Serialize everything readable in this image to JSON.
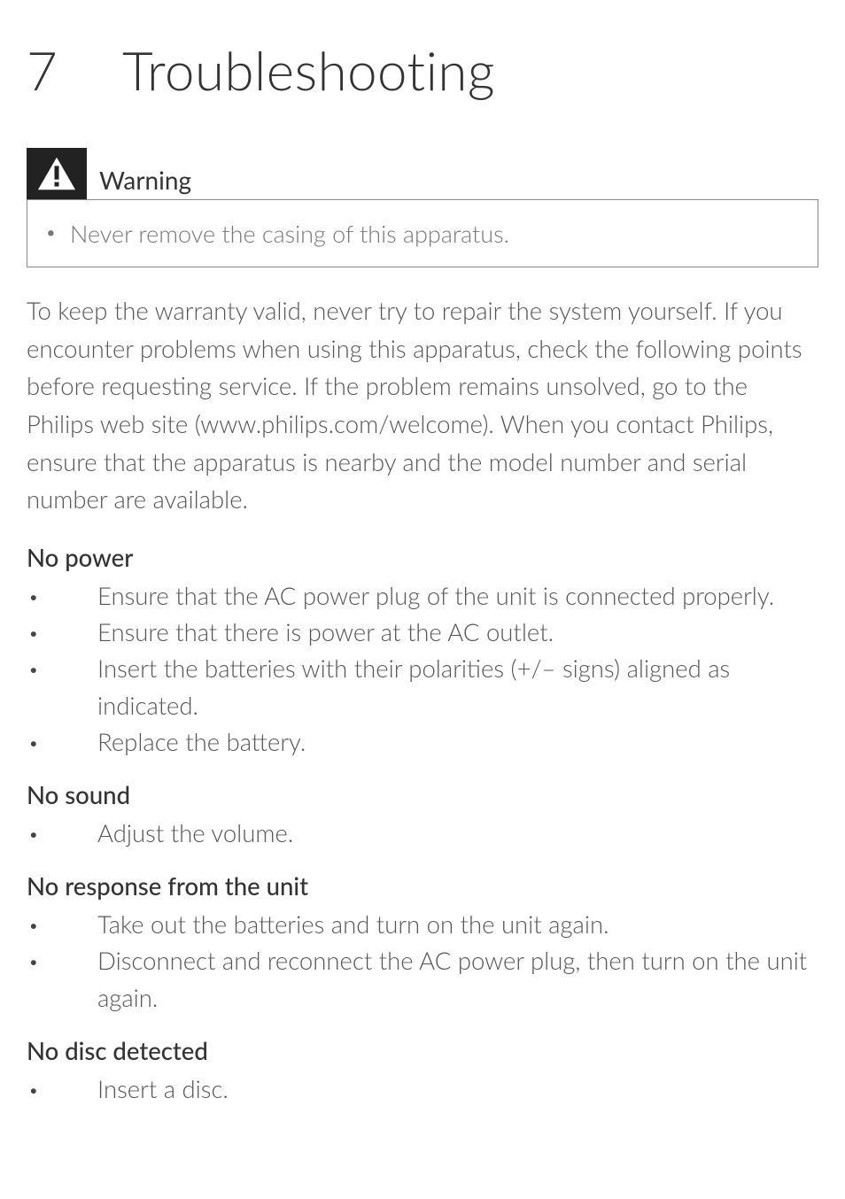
{
  "chapter": {
    "number": "7",
    "title": "Troubleshooting"
  },
  "warning": {
    "label": "Warning",
    "items": [
      "Never remove the casing of this apparatus."
    ]
  },
  "intro": "To keep the warranty valid, never try to repair the system yourself. If you encounter problems when using this apparatus, check the following points before requesting service. If the problem remains unsolved, go to the Philips web site (www.philips.com/welcome). When you contact Philips, ensure that the apparatus is nearby and the model number and serial number are available.",
  "sections": [
    {
      "heading": "No power",
      "items": [
        "Ensure that the AC power plug of the unit is connected properly.",
        "Ensure that there is power at the AC outlet.",
        "Insert the batteries with their polarities (+/– signs) aligned as indicated.",
        "Replace the battery."
      ]
    },
    {
      "heading": "No sound",
      "items": [
        "Adjust the volume."
      ]
    },
    {
      "heading": "No response from the unit",
      "items": [
        "Take out the batteries and turn on the unit again.",
        "Disconnect and reconnect the AC power plug, then turn on the unit again."
      ]
    },
    {
      "heading": "No disc detected",
      "items": [
        "Insert a disc."
      ]
    }
  ]
}
